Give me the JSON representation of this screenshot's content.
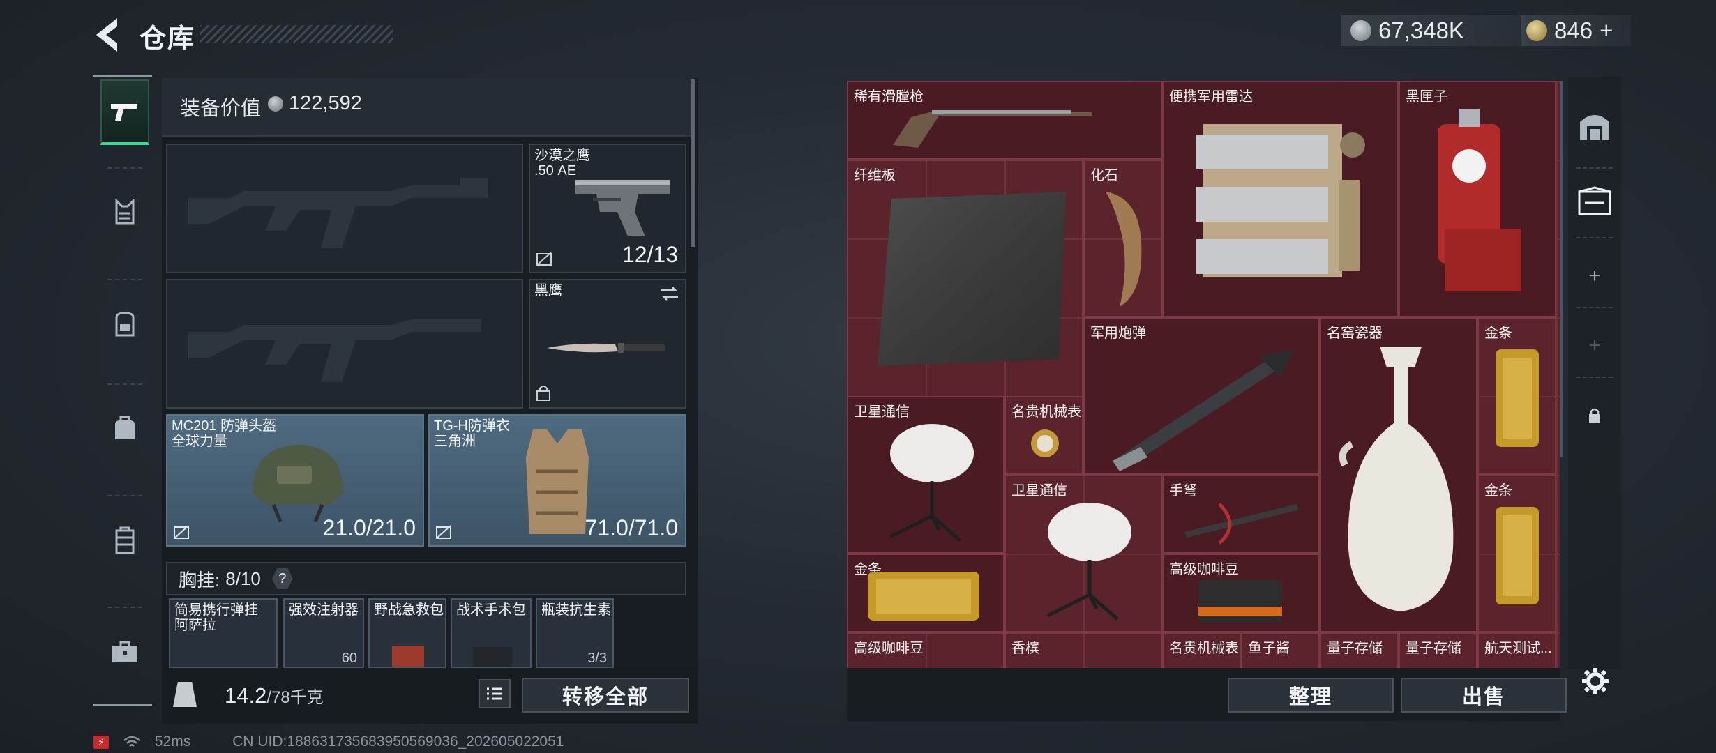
{
  "header": {
    "title": "仓库",
    "currency_primary": "67,348K",
    "currency_secondary": "846",
    "currency_secondary_add": "+"
  },
  "loadout": {
    "equipment_value_label": "装备价值",
    "equipment_value": "122,592",
    "pistol": {
      "name": "沙漠之鹰\n.50 AE",
      "count": "12/13"
    },
    "melee": {
      "name": "黑鹰"
    },
    "helmet": {
      "name": "MC201 防弹头盔\n全球力量",
      "durability": "21.0/21.0"
    },
    "armor": {
      "name": "TG-H防弹衣\n三角洲",
      "durability": "71.0/71.0"
    },
    "chest_rig": {
      "label": "胸挂:",
      "capacity": "8/10",
      "help": "?"
    },
    "rig_items": [
      {
        "name": "简易携行弹挂\n阿萨拉",
        "count": ""
      },
      {
        "name": "强效注射器",
        "count": "60"
      },
      {
        "name": "野战急救包",
        "count": ""
      },
      {
        "name": "战术手术包",
        "count": ""
      },
      {
        "name": "瓶装抗生素",
        "count": "3/3"
      }
    ],
    "weight": "14.2",
    "weight_max": "/78千克",
    "transfer_all": "转移全部"
  },
  "storage": {
    "items": [
      {
        "name": "稀有滑膛枪"
      },
      {
        "name": "便携军用雷达"
      },
      {
        "name": "黑匣子"
      },
      {
        "name": "纤维板"
      },
      {
        "name": "化石"
      },
      {
        "name": "军用炮弹"
      },
      {
        "name": "名窑瓷器"
      },
      {
        "name": "金条"
      },
      {
        "name": "卫星通信"
      },
      {
        "name": "名贵机械表"
      },
      {
        "name": "卫星通信"
      },
      {
        "name": "手弩"
      },
      {
        "name": "金条"
      },
      {
        "name": "金条"
      },
      {
        "name": "高级咖啡豆"
      },
      {
        "name": "高级咖啡豆"
      },
      {
        "name": "香槟"
      },
      {
        "name": "名贵机械表"
      },
      {
        "name": "鱼子酱"
      },
      {
        "name": "量子存储"
      },
      {
        "name": "量子存储"
      },
      {
        "name": "航天测试..."
      }
    ],
    "organize": "整理",
    "sell": "出售"
  },
  "status_bar": {
    "ping": "52ms",
    "uid": "CN UID:188631735683950569036_202605022051"
  },
  "colors": {
    "storage_bg": "#5b232b",
    "active_tab_accent": "#30e08a",
    "armor_slot_bg": "#4f6a80"
  },
  "icons": [
    "back-arrow-icon",
    "silver-coin-icon",
    "gold-coin-icon",
    "pistol-icon",
    "vest-icon",
    "backpack-icon",
    "bag-icon",
    "case-icon",
    "toolbox-icon",
    "swap-icon",
    "lock-icon",
    "list-icon",
    "weight-icon",
    "settings-icon",
    "wifi-icon",
    "battery-icon"
  ]
}
